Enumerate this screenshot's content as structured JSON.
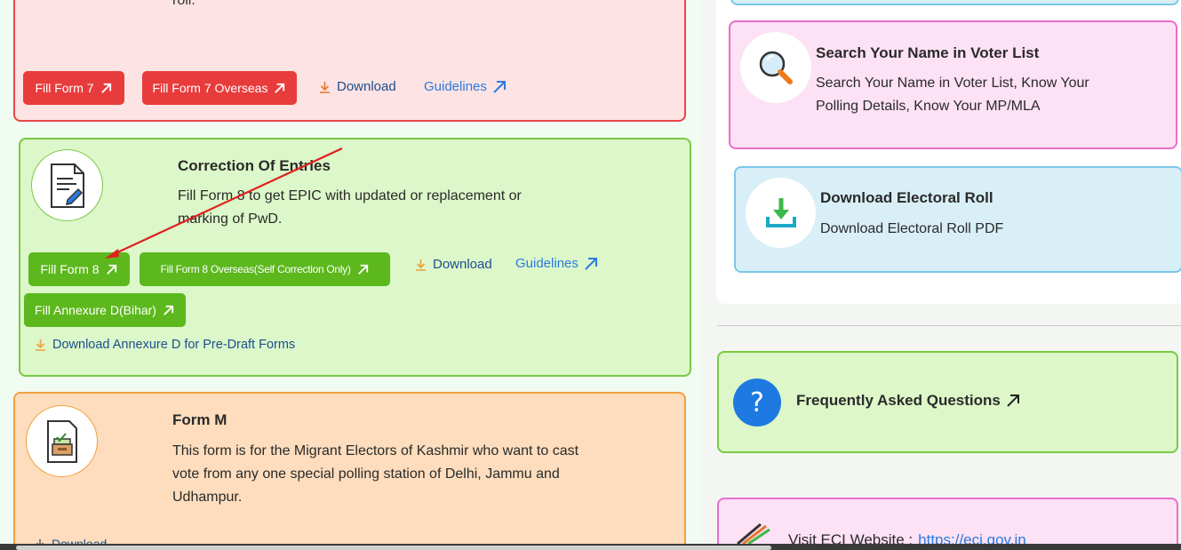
{
  "form7": {
    "roll_text": "roll.",
    "buttons": {
      "fill_form": "Fill Form 7",
      "fill_overseas": "Fill Form 7 Overseas"
    },
    "download": "Download",
    "guidelines": "Guidelines"
  },
  "form8": {
    "title": "Correction Of Entries",
    "description": "Fill Form 8 to get EPIC with updated or replacement or marking of PwD.",
    "buttons": {
      "fill_form": "Fill Form 8",
      "fill_overseas": "Fill Form 8 Overseas(Self Correction Only)",
      "fill_annexure": "Fill Annexure D(Bihar)"
    },
    "download": "Download",
    "guidelines": "Guidelines",
    "download_annexure": "Download Annexure D for Pre-Draft Forms"
  },
  "formM": {
    "title": "Form M",
    "description": "This form is for the Migrant Electors of Kashmir who want to cast vote from any one special polling station of Delhi, Jammu and Udhampur.",
    "download_partial": "Download"
  },
  "search_card": {
    "title": "Search Your Name in Voter List",
    "description": "Search Your Name in Voter List, Know Your Polling Details, Know Your MP/MLA"
  },
  "electoral_roll_card": {
    "title": "Download Electoral Roll",
    "description": "Download Electoral Roll PDF"
  },
  "faq": {
    "label": "Frequently Asked Questions"
  },
  "eci": {
    "label": "Visit ECI Website : ",
    "link": "https://eci.gov.in"
  },
  "colors": {
    "red_button": "#e83c3c",
    "green_button": "#5cb81d",
    "link_blue": "#2b7be0",
    "link_dark": "#1d4f8c",
    "annotation_arrow": "#e02020"
  },
  "icons": [
    "arrow-up-right-icon",
    "download-icon",
    "edit-document-icon",
    "ballot-box-icon",
    "magnifier-icon",
    "download-tray-icon",
    "question-icon",
    "eci-logo-icon"
  ]
}
